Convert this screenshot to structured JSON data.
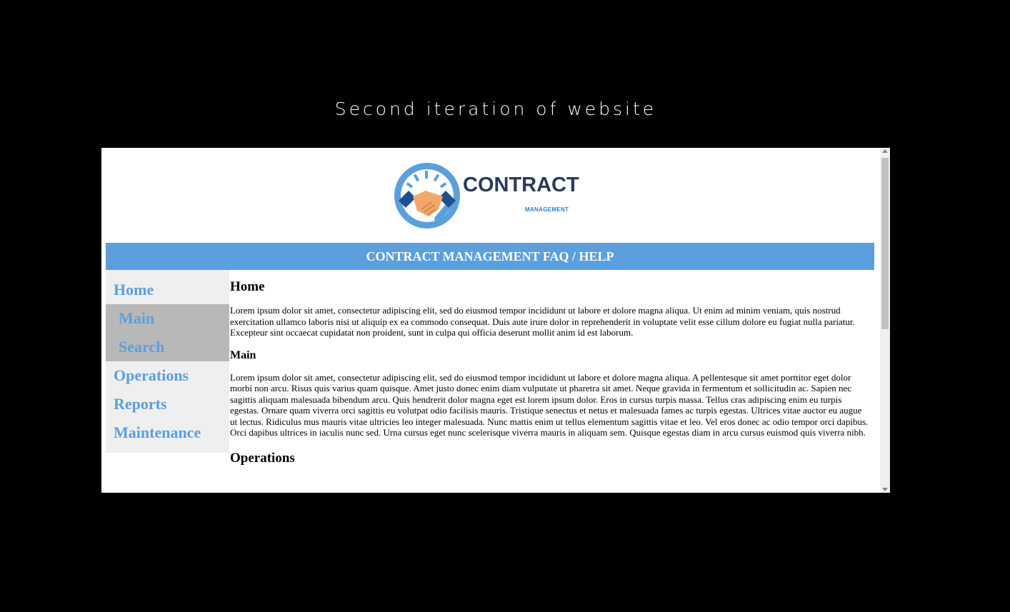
{
  "caption": "Second iteration of website",
  "logo": {
    "word": "CONTRACT",
    "sub": "MANAGEMENT"
  },
  "banner": "CONTRACT MANAGEMENT FAQ / HELP",
  "nav": {
    "home": "Home",
    "main": "Main",
    "search": "Search",
    "operations": "Operations",
    "reports": "Reports",
    "maintenance": "Maintenance"
  },
  "content": {
    "home_heading": "Home",
    "home_text": "Lorem ipsum dolor sit amet, consectetur adipiscing elit, sed do eiusmod tempor incididunt ut labore et dolore magna aliqua. Ut enim ad minim veniam, quis nostrud exercitation ullamco laboris nisi ut aliquip ex ea commodo consequat. Duis aute irure dolor in reprehenderit in voluptate velit esse cillum dolore eu fugiat nulla pariatur. Excepteur sint occaecat cupidatat non proident, sunt in culpa qui officia deserunt mollit anim id est laborum.",
    "main_heading": "Main",
    "main_text": "Lorem ipsum dolor sit amet, consectetur adipiscing elit, sed do eiusmod tempor incididunt ut labore et dolore magna aliqua. A pellentesque sit amet porttitor eget dolor morbi non arcu. Risus quis varius quam quisque. Amet justo donec enim diam vulputate ut pharetra sit amet. Neque gravida in fermentum et sollicitudin ac. Sapien nec sagittis aliquam malesuada bibendum arcu. Quis hendrerit dolor magna eget est lorem ipsum dolor. Eros in cursus turpis massa. Tellus cras adipiscing enim eu turpis egestas. Ornare quam viverra orci sagittis eu volutpat odio facilisis mauris. Tristique senectus et netus et malesuada fames ac turpis egestas. Ultrices vitae auctor eu augue ut lectus. Ridiculus mus mauris vitae ultricies leo integer malesuada. Nunc mattis enim ut tellus elementum sagittis vitae et leo. Vel eros donec ac odio tempor orci dapibus. Orci dapibus ultrices in iaculis nunc sed. Urna cursus eget nunc scelerisque viverra mauris in aliquam sem. Quisque egestas diam in arcu cursus euismod quis viverra nibh.",
    "operations_heading": "Operations"
  },
  "colors": {
    "accent": "#5b9fdc",
    "sidebar_bg": "#efefef",
    "sub_item_bg": "#b8b8b8",
    "logo_text": "#2a3a5a"
  },
  "icons": {
    "logo": "handshake-icon"
  }
}
